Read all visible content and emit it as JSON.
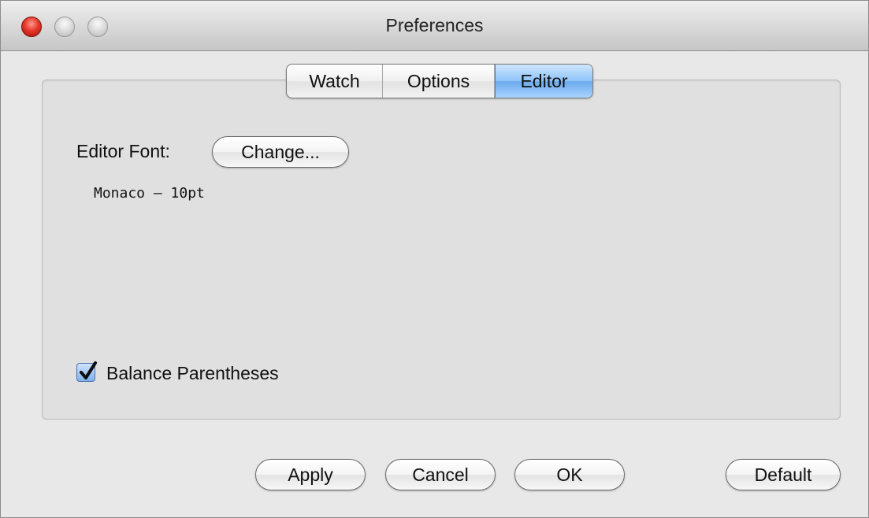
{
  "window": {
    "title": "Preferences"
  },
  "tabs": [
    {
      "label": "Watch",
      "selected": false
    },
    {
      "label": "Options",
      "selected": false
    },
    {
      "label": "Editor",
      "selected": true
    }
  ],
  "editor": {
    "font_label": "Editor Font:",
    "change_button": "Change...",
    "current_font": "Monaco – 10pt",
    "balance_parens_label": "Balance Parentheses",
    "balance_parens_checked": true
  },
  "buttons": {
    "apply": "Apply",
    "cancel": "Cancel",
    "ok": "OK",
    "default": "Default"
  },
  "icons": {
    "close": "close-icon",
    "minimize": "minimize-icon",
    "zoom": "zoom-icon",
    "checkmark": "checkmark-icon"
  },
  "colors": {
    "selected_tab": "#8ec3f7",
    "close_button": "#e6392a"
  }
}
